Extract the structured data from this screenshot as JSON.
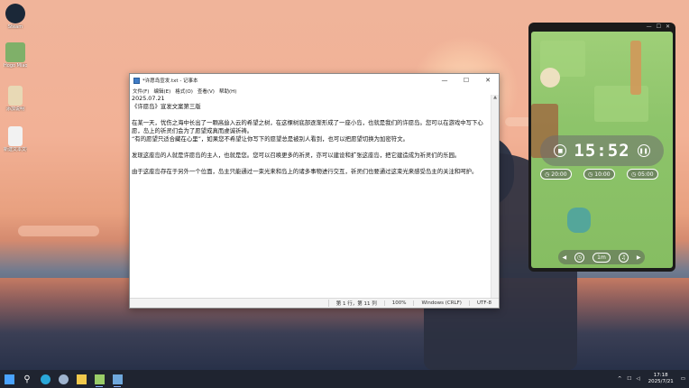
{
  "desktop": {
    "icons": [
      {
        "label": "Steam",
        "icon": "steam-icon",
        "color": "#1b2838"
      },
      {
        "label": "Hogo Miaowu ...",
        "icon": "game-icon",
        "color": "#7fb069"
      },
      {
        "label": "添加说明",
        "icon": "document-icon",
        "color": "#e8d9b5"
      },
      {
        "label": "新建文本文档",
        "icon": "text-file-icon",
        "color": "#f2f2f2"
      }
    ]
  },
  "notepad": {
    "title": "*许愿岛宣发.txt - 记事本",
    "window_controls": {
      "minimize": "—",
      "maximize": "☐",
      "close": "✕"
    },
    "menu": [
      "文件(F)",
      "编辑(E)",
      "格式(O)",
      "查看(V)",
      "帮助(H)"
    ],
    "lines": [
      "2025.07.21",
      "《许愿岛》宣发文案第三版",
      "",
      "在某一天，忧伤之海中长出了一颗高耸入云的希望之树，在这棵树底部逐渐形成了一座小岛，也就是我们的许愿岛。您可以在游戏中写下心愿，岛上的祈灵们会为了愿望成真而虔诚祈祷。",
      "“有的愿望只适合藏在心里”，如果您不希望让你写下的愿望总是被别人看到，也可以把愿望切换为加密符文。",
      "",
      "发现这座岛的人就是许愿岛的主人，也就是您。您可以召唤更多的祈灵，亦可以建设和扩张这座岛，把它建造成为祈灵们的乐园。",
      "",
      "由于这座岛存在于另外一个位面，岛主只能通过一束光来和岛上的诸多事物进行交互，祈灵们也要通过这束光来感受岛主的关注和呵护。"
    ],
    "status": {
      "position": "第 1 行，第 11 列",
      "zoom": "100%",
      "line_ending": "Windows (CRLF)",
      "encoding": "UTF-8"
    }
  },
  "timer_widget": {
    "time": "15:52",
    "stop_icon": "stop-icon",
    "pause_icon": "pause-icon",
    "presets": [
      "20:00",
      "10:00",
      "05:00"
    ],
    "bottom_controls": {
      "prev": "◀",
      "next": "▶",
      "center": "1m"
    },
    "window_controls": {
      "minimize": "—",
      "maximize": "☐",
      "close": "✕"
    }
  },
  "taskbar": {
    "apps": [
      {
        "name": "start-button",
        "color": "#4aa3ff"
      },
      {
        "name": "search-button",
        "color": "#ffffff"
      },
      {
        "name": "edge-app",
        "color": "#2aa7d8"
      },
      {
        "name": "steam-app",
        "color": "#9fb4cf"
      },
      {
        "name": "explorer-app",
        "color": "#f2c94c"
      },
      {
        "name": "game-app",
        "color": "#9acd68"
      },
      {
        "name": "notepad-app",
        "color": "#6fa8dc"
      }
    ],
    "tray": {
      "chevron": "^",
      "time": "17:18",
      "date": "2025/7/21"
    }
  }
}
